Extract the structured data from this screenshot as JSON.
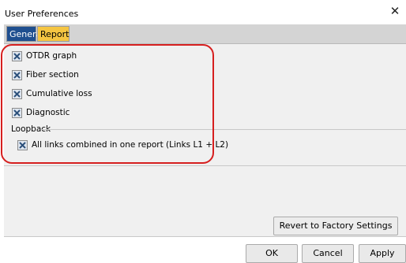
{
  "window": {
    "title": "User Preferences",
    "close_icon": "close-icon"
  },
  "tabs": [
    {
      "label": "General",
      "active": false
    },
    {
      "label": "Report",
      "active": true
    }
  ],
  "report": {
    "options": [
      {
        "label": "OTDR graph",
        "checked": true
      },
      {
        "label": "Fiber section",
        "checked": true
      },
      {
        "label": "Cumulative loss",
        "checked": true
      },
      {
        "label": "Diagnostic",
        "checked": true
      }
    ],
    "loopback": {
      "group_label": "Loopback",
      "option": {
        "label": "All links combined in one report (Links L1 + L2)",
        "checked": true
      }
    }
  },
  "buttons": {
    "revert": "Revert to Factory Settings",
    "ok": "OK",
    "cancel": "Cancel",
    "apply": "Apply"
  },
  "colors": {
    "active_tab": "#f5c542",
    "inactive_tab": "#1f4f8f",
    "highlight": "#d61f1f"
  }
}
